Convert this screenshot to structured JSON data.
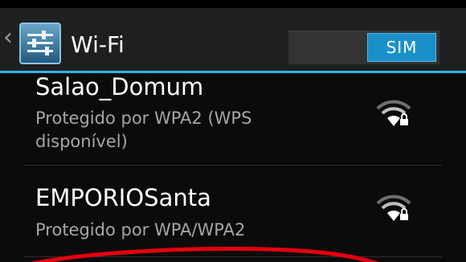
{
  "header": {
    "title": "Wi-Fi",
    "toggle_label": "SIM"
  },
  "networks": [
    {
      "ssid": "Salao_Domum",
      "status": "Protegido por WPA2 (WPS disponível)",
      "icon": "wifi-locked-icon"
    },
    {
      "ssid": "EMPORIOSanta",
      "status": "Protegido por WPA/WPA2",
      "icon": "wifi-locked-icon"
    }
  ],
  "colors": {
    "accent": "#33b5e5",
    "toggle_on": "#1b90c8",
    "annotation": "#e3000f"
  }
}
